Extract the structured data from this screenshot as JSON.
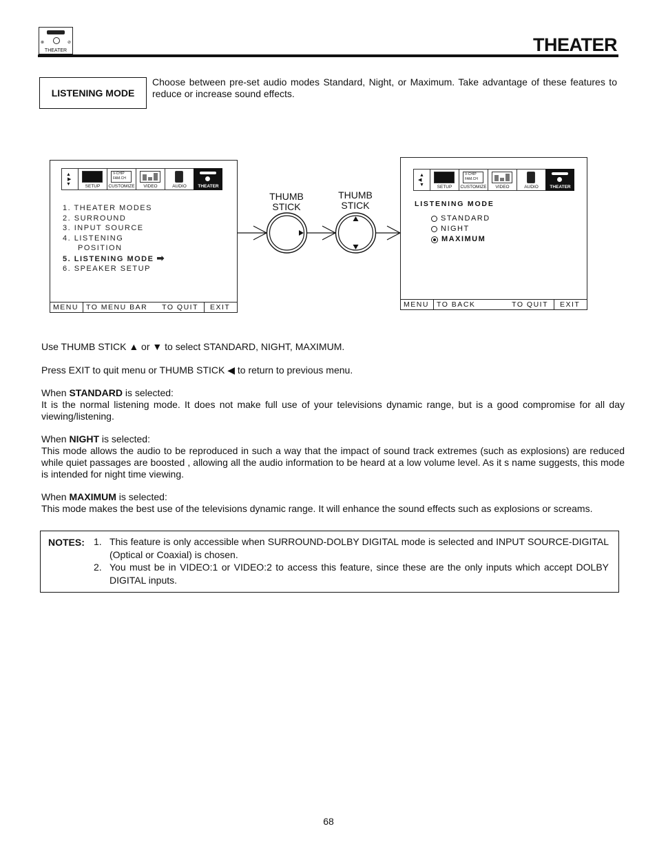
{
  "header": {
    "section_icon_label": "THEATER",
    "page_title": "THEATER"
  },
  "intro": {
    "feature_label": "LISTENING MODE",
    "description": "Choose between pre-set audio modes Standard, Night, or Maximum.  Take advantage of these features to reduce or increase sound effects."
  },
  "menu_tabs": [
    {
      "label": "SETUP",
      "icon": "setup-icon"
    },
    {
      "label": "CUSTOMIZE",
      "icon": "customize-icon",
      "lines": [
        "V-CHIP",
        "FAM.CH"
      ]
    },
    {
      "label": "VIDEO",
      "icon": "video-icon"
    },
    {
      "label": "AUDIO",
      "icon": "audio-speaker-icon"
    },
    {
      "label": "THEATER",
      "icon": "theater-icon",
      "active": true
    }
  ],
  "screen1": {
    "items": [
      "1. THEATER MODES",
      "2. SURROUND",
      "3. INPUT SOURCE",
      "4. LISTENING",
      "POSITION",
      "5. LISTENING MODE",
      "6. SPEAKER SETUP"
    ],
    "selected_index": 5,
    "footer": {
      "menu": "MENU",
      "action": "TO MENU BAR",
      "quit": "TO QUIT",
      "exit": "EXIT"
    }
  },
  "thumbsticks": [
    {
      "label_line1": "THUMB",
      "label_line2": "STICK",
      "direction": "right"
    },
    {
      "label_line1": "THUMB",
      "label_line2": "STICK",
      "direction": "up-down"
    }
  ],
  "screen2": {
    "title": "LISTENING MODE",
    "options": [
      {
        "label": "STANDARD",
        "selected": false
      },
      {
        "label": "NIGHT",
        "selected": false
      },
      {
        "label": "MAXIMUM",
        "selected": true
      }
    ],
    "footer": {
      "menu": "MENU",
      "action": "TO BACK",
      "quit": "TO QUIT",
      "exit": "EXIT"
    }
  },
  "instructions": {
    "select": {
      "pre": "Use THUMB STICK ",
      "up": "▲",
      "mid": " or ",
      "down": "▼",
      "post": " to select STANDARD, NIGHT, MAXIMUM."
    },
    "exit": {
      "pre": "Press EXIT to quit menu or THUMB STICK ",
      "left": "◀",
      "post": " to return to previous menu."
    }
  },
  "modes": [
    {
      "when": "When ",
      "name": "STANDARD",
      "is_selected": " is selected:",
      "text": "It is the normal listening mode.  It does not make full use of your televisions dynamic range, but is a good compromise for all day viewing/listening."
    },
    {
      "when": "When ",
      "name": "NIGHT",
      "is_selected": " is selected:",
      "text": "This mode allows the audio to be reproduced in such a way that the impact of sound track extremes (such as explosions) are reduced while quiet passages are  boosted , allowing all the audio information to be heard at a low volume level.  As it s name suggests, this mode is intended for night time viewing."
    },
    {
      "when": "When ",
      "name": "MAXIMUM",
      "is_selected": " is selected:",
      "text": "This mode makes the best use of the televisions dynamic range.  It will enhance the sound effects such as explosions or screams."
    }
  ],
  "notes": {
    "label": "NOTES:",
    "items": [
      {
        "num": "1.",
        "text": "This feature is only accessible when SURROUND-DOLBY DIGITAL mode is selected and INPUT SOURCE-DIGITAL (Optical or Coaxial) is chosen."
      },
      {
        "num": "2.",
        "text": "You must be in VIDEO:1 or VIDEO:2 to access this feature, since these are the only inputs which accept DOLBY DIGITAL inputs."
      }
    ]
  },
  "page_number": "68"
}
